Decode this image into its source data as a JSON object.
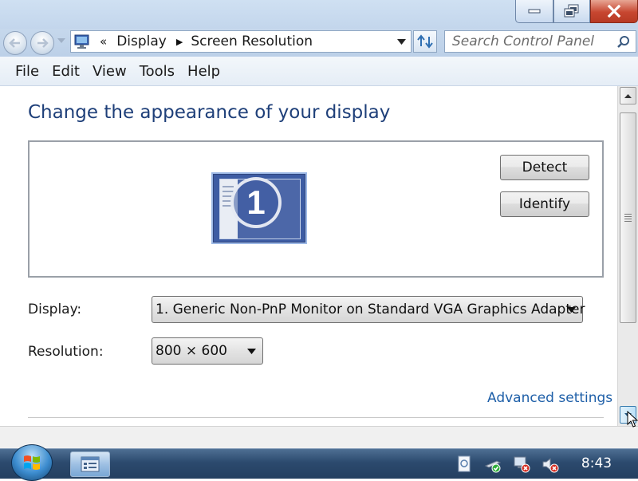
{
  "window": {
    "buttons": [
      "minimize",
      "restore",
      "close"
    ]
  },
  "address_bar": {
    "overflow": "«",
    "crumbs": [
      "Display",
      "Screen Resolution"
    ]
  },
  "search": {
    "placeholder": "Search Control Panel"
  },
  "menu": {
    "items": [
      "File",
      "Edit",
      "View",
      "Tools",
      "Help"
    ]
  },
  "content": {
    "title": "Change the appearance of your display",
    "monitor_number": "1",
    "detect_button": "Detect",
    "identify_button": "Identify",
    "display_label": "Display:",
    "display_value": "1. Generic Non-PnP Monitor on Standard VGA Graphics Adapter",
    "resolution_label": "Resolution:",
    "resolution_value": "800 × 600",
    "advanced_link": "Advanced settings"
  },
  "taskbar": {
    "clock": "8:43"
  },
  "colors": {
    "title_blue": "#1e3f79",
    "link_blue": "#1e5fa8",
    "taskbar": "#2c4a6e"
  }
}
